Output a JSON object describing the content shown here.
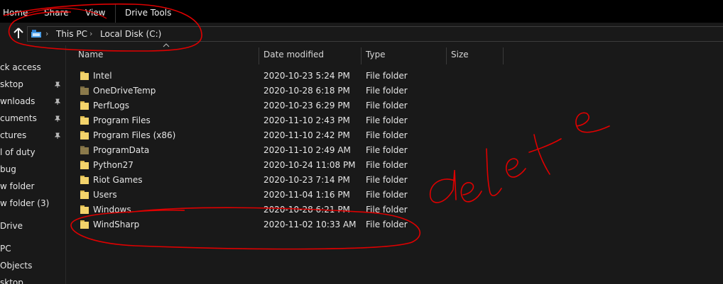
{
  "ribbon": {
    "tabs": [
      "Home",
      "Share",
      "View",
      "Drive Tools"
    ]
  },
  "address": {
    "crumbs": [
      "This PC",
      "Local Disk (C:)"
    ]
  },
  "nav": {
    "items": [
      {
        "label": "ck access",
        "pinned": false
      },
      {
        "label": "sktop",
        "pinned": true
      },
      {
        "label": "wnloads",
        "pinned": true
      },
      {
        "label": "cuments",
        "pinned": true
      },
      {
        "label": "ctures",
        "pinned": true
      },
      {
        "label": "l of duty",
        "pinned": false
      },
      {
        "label": "bug",
        "pinned": false
      },
      {
        "label": "w folder",
        "pinned": false
      },
      {
        "label": "w folder (3)",
        "pinned": false
      },
      {
        "label": "Drive",
        "pinned": false
      },
      {
        "label": "PC",
        "pinned": false
      },
      {
        "label": "Objects",
        "pinned": false
      },
      {
        "label": "sktop",
        "pinned": false
      }
    ]
  },
  "columns": [
    "Name",
    "Date modified",
    "Type",
    "Size"
  ],
  "files": [
    {
      "name": "Intel",
      "date": "2020-10-23 5:24 PM",
      "type": "File folder",
      "icon": "folder-icon"
    },
    {
      "name": "OneDriveTemp",
      "date": "2020-10-28 6:18 PM",
      "type": "File folder",
      "icon": "folder-dim-icon"
    },
    {
      "name": "PerfLogs",
      "date": "2020-10-23 6:29 PM",
      "type": "File folder",
      "icon": "folder-icon"
    },
    {
      "name": "Program Files",
      "date": "2020-11-10 2:43 PM",
      "type": "File folder",
      "icon": "folder-icon"
    },
    {
      "name": "Program Files (x86)",
      "date": "2020-11-10 2:42 PM",
      "type": "File folder",
      "icon": "folder-icon"
    },
    {
      "name": "ProgramData",
      "date": "2020-11-10 2:49 AM",
      "type": "File folder",
      "icon": "folder-dim-icon"
    },
    {
      "name": "Python27",
      "date": "2020-10-24 11:08 PM",
      "type": "File folder",
      "icon": "folder-icon"
    },
    {
      "name": "Riot Games",
      "date": "2020-10-23 7:14 PM",
      "type": "File folder",
      "icon": "folder-icon"
    },
    {
      "name": "Users",
      "date": "2020-11-04 1:16 PM",
      "type": "File folder",
      "icon": "folder-icon"
    },
    {
      "name": "Windows",
      "date": "2020-10-28 6:21 PM",
      "type": "File folder",
      "icon": "folder-icon"
    },
    {
      "name": "WindSharp",
      "date": "2020-11-02 10:33 AM",
      "type": "File folder",
      "icon": "folder-icon"
    }
  ],
  "annotation": {
    "text": "delete",
    "color": "#e00000"
  }
}
